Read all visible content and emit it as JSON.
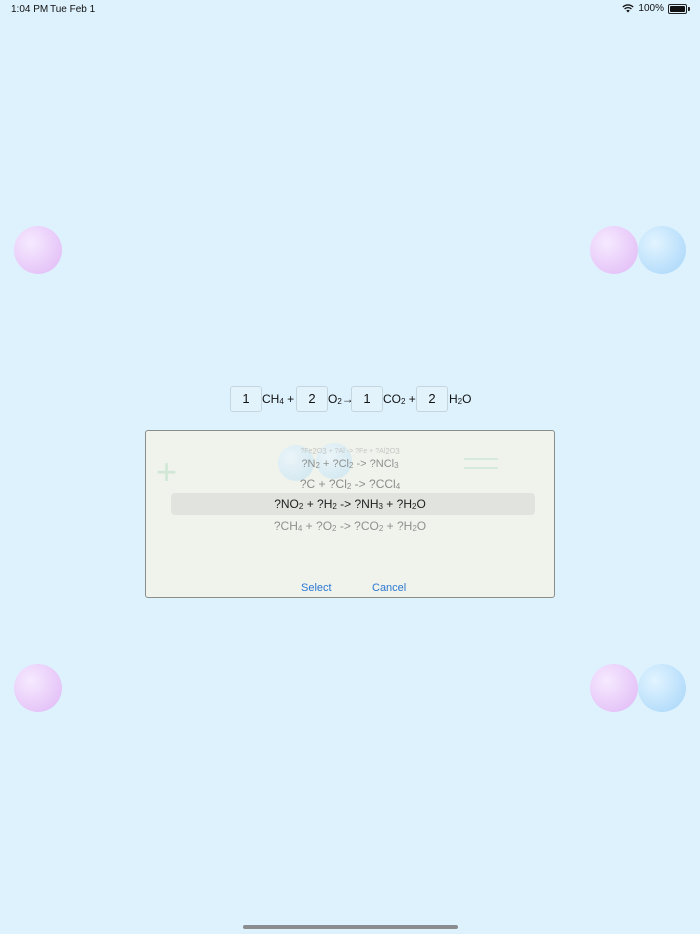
{
  "status_bar": {
    "time": "1:04 PM",
    "date": "Tue Feb 1",
    "battery": "100%",
    "icons": [
      "wifi-icon",
      "battery-icon"
    ]
  },
  "equation": {
    "coef1": "1",
    "species1": {
      "base": "CH",
      "sub": "4",
      "suffix": " +"
    },
    "coef2": "2",
    "species2": {
      "base": "O",
      "sub": "2",
      "suffix": "→"
    },
    "coef3": "1",
    "species3": {
      "base": "CO",
      "sub": "2",
      "suffix": " +"
    },
    "coef4": "2",
    "species4": {
      "base": "H",
      "sub": "2",
      "suffix": "O"
    }
  },
  "picker": {
    "options": [
      {
        "p1": "?Fe",
        "s1": "2",
        "p2": "O",
        "s2": "3",
        "p3": " + ?Al -> ?Fe + ?Al",
        "s3": "2",
        "p4": "O",
        "s4": "3"
      },
      {
        "p1": "?N",
        "s1": "2",
        "p2": " + ?Cl",
        "s2": "2",
        "p3": " -> ?NCl",
        "s3": "3"
      },
      {
        "p1": "?C + ?Cl",
        "s1": "2",
        "p2": " -> ?CCl",
        "s2": "4"
      },
      {
        "p1": "?NO",
        "s1": "2",
        "p2": " + ?H",
        "s2": "2",
        "p3": " -> ?NH",
        "s3": "3",
        "p4": " + ?H",
        "s4": "2",
        "p5": "O"
      },
      {
        "p1": "?CH",
        "s1": "4",
        "p2": " + ?O",
        "s2": "2",
        "p3": " -> ?CO",
        "s3": "2",
        "p4": " + ?H",
        "s4": "2",
        "p5": "O"
      }
    ],
    "selected_index": 3,
    "select_label": "Select",
    "cancel_label": "Cancel"
  },
  "colors": {
    "background": "#def2fd",
    "dialog": "#f0f2ec",
    "button_text": "#2a78d2"
  }
}
